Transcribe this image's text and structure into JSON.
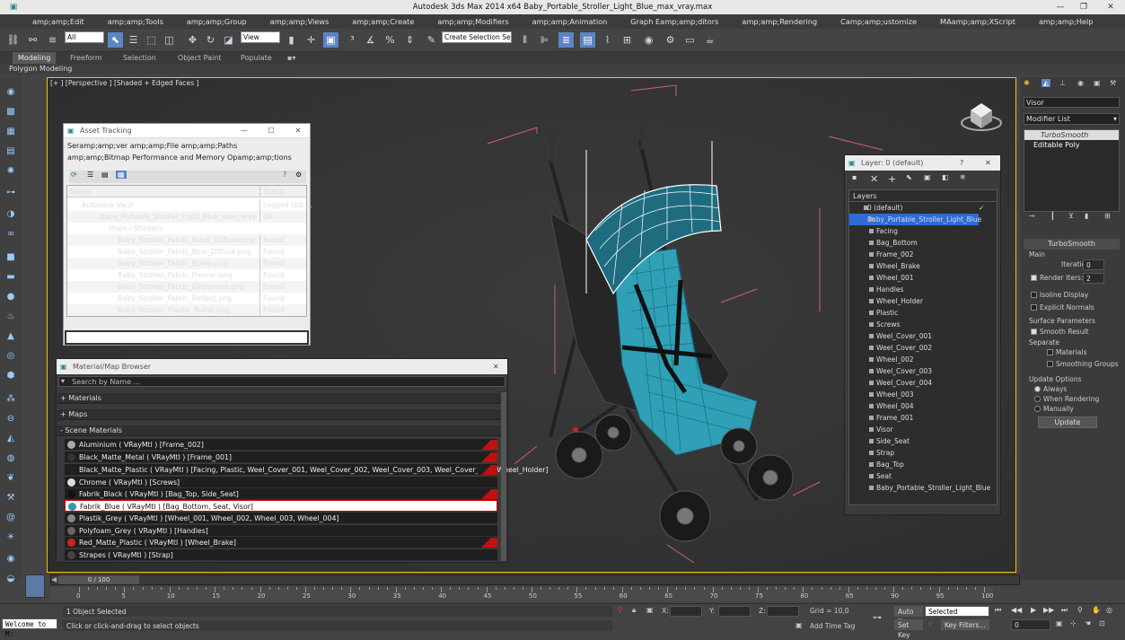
{
  "window": {
    "title": "Autodesk 3ds Max  2014 x64    Baby_Portable_Stroller_Light_Blue_max_vray.max"
  },
  "menu": [
    "amp;amp;Edit",
    "amp;amp;Tools",
    "amp;amp;Group",
    "amp;amp;Views",
    "amp;amp;Create",
    "amp;amp;Modifiers",
    "amp;amp;Animation",
    "Graph Eamp;amp;ditors",
    "amp;amp;Rendering",
    "Camp;amp;ustomize",
    "MAamp;amp;XScript",
    "amp;amp;Help"
  ],
  "toolbar": {
    "filter": "All",
    "refcoord": "View",
    "selection_set": "Create Selection Se"
  },
  "ribbon": {
    "tabs": [
      "Modeling",
      "Freeform",
      "Selection",
      "Object Paint",
      "Populate"
    ],
    "sub": "Polygon Modeling"
  },
  "viewport": {
    "label": "[+ ] [Perspective ] [Shaded + Edged Faces ]"
  },
  "asset": {
    "title": "Asset Tracking",
    "menu1": "Seramp;amp;ver    amp;amp;File    amp;amp;Paths",
    "menu2": "amp;amp;Bitmap Performance and Memory    Opamp;amp;tions",
    "col_name": "Name",
    "col_status": "Status",
    "rows": [
      {
        "name": "Autodesk Vault",
        "status": "Logged Out ..."
      },
      {
        "name": "Baby_Portable_Stroller_Light_Blue_max_vray.max",
        "status": "Ok"
      },
      {
        "name": "Maps / Shaders",
        "status": ""
      },
      {
        "name": "Baby_Stroller_Fabric_Black_Diffuse.png",
        "status": "Found"
      },
      {
        "name": "Baby_Stroller_Fabric_Blue_Diffuse.png",
        "status": "Found"
      },
      {
        "name": "Baby_Stroller_Fabric_Bump.png",
        "status": "Found"
      },
      {
        "name": "Baby_Stroller_Fabric_Fresnel.png",
        "status": "Found"
      },
      {
        "name": "Baby_Stroller_Fabric_Glossiness.png",
        "status": "Found"
      },
      {
        "name": "Baby_Stroller_Fabric_Reflect.png",
        "status": "Found"
      },
      {
        "name": "Baby_Stroller_Plastic_Bump.png",
        "status": "Found"
      }
    ]
  },
  "mmb": {
    "title": "Material/Map Browser",
    "search": "Search by Name ...",
    "cats": [
      "+ Materials",
      "+ Maps",
      "- Scene Materials"
    ],
    "rows": [
      "Aluminium  ( VRayMtl ) [Frame_002]",
      "Black_Matte_Metal  ( VRayMtl ) [Frame_001]",
      "Black_Matte_Plastic  ( VRayMtl ) [Facing, Plastic, Weel_Cover_001, Weel_Cover_002, Weel_Cover_003, Weel_Cover_004, Wheel_Holder]",
      "Chrome  ( VRayMtl ) [Screws]",
      "Fabrik_Black  ( VRayMtl ) [Bag_Top, Side_Seat]",
      "Fabrik_Blue  ( VRayMtl ) [Bag_Bottom, Seat, Visor]",
      "Plastik_Grey  ( VRayMtl ) [Wheel_001, Wheel_002, Wheel_003, Wheel_004]",
      "Polyfoam_Grey  ( VRayMtl ) [Handles]",
      "Red_Matte_Plastic  ( VRayMtl ) [Wheel_Brake]",
      "Strapes  ( VRayMtl ) [Strap]"
    ]
  },
  "layer": {
    "title": "Layer: 0 (default)",
    "header": "Layers",
    "items": [
      "0 (default)",
      "Baby_Portable_Stroller_Light_Blue",
      "Facing",
      "Bag_Bottom",
      "Frame_002",
      "Wheel_Brake",
      "Wheel_001",
      "Handles",
      "Wheel_Holder",
      "Plastic",
      "Screws",
      "Weel_Cover_001",
      "Weel_Cover_002",
      "Wheel_002",
      "Weel_Cover_003",
      "Weel_Cover_004",
      "Wheel_003",
      "Wheel_004",
      "Frame_001",
      "Visor",
      "Side_Seat",
      "Strap",
      "Bag_Top",
      "Seat",
      "Baby_Portable_Stroller_Light_Blue"
    ]
  },
  "cmd": {
    "object": "Visor",
    "modlist": "Modifier List",
    "stack": [
      "TurboSmooth",
      "Editable Poly"
    ],
    "rollout": "TurboSmooth",
    "main": "Main",
    "iter_label": "Iterations:",
    "iter_val": "0",
    "render_label": "Render Iters:",
    "render_val": "2",
    "isoline": "Isoline Display",
    "explicit": "Explicit Normals",
    "surface": "Surface Parameters",
    "smooth": "Smooth Result",
    "separate": "Separate",
    "materials": "Materials",
    "smgroups": "Smoothing Groups",
    "update_opts": "Update Options",
    "always": "Always",
    "when_render": "When Rendering",
    "manually": "Manually",
    "update_btn": "Update"
  },
  "time": {
    "frame": "0 / 100",
    "ticks": [
      "0",
      "5",
      "10",
      "15",
      "20",
      "25",
      "30",
      "35",
      "40",
      "45",
      "50",
      "55",
      "60",
      "65",
      "70",
      "75",
      "80",
      "85",
      "90",
      "95",
      "100"
    ]
  },
  "status": {
    "listener": "Welcome to M:",
    "selected": "1 Object Selected",
    "prompt": "Click or click-and-drag to select objects",
    "x": "X:",
    "y": "Y:",
    "z": "Z:",
    "grid": "Grid = 10,0",
    "addtime": "Add Time Tag",
    "autokey": "Auto Key",
    "setkey": "Set Key",
    "selected_dd": "Selected",
    "keyfilters": "Key Filters...",
    "frame": "0"
  }
}
